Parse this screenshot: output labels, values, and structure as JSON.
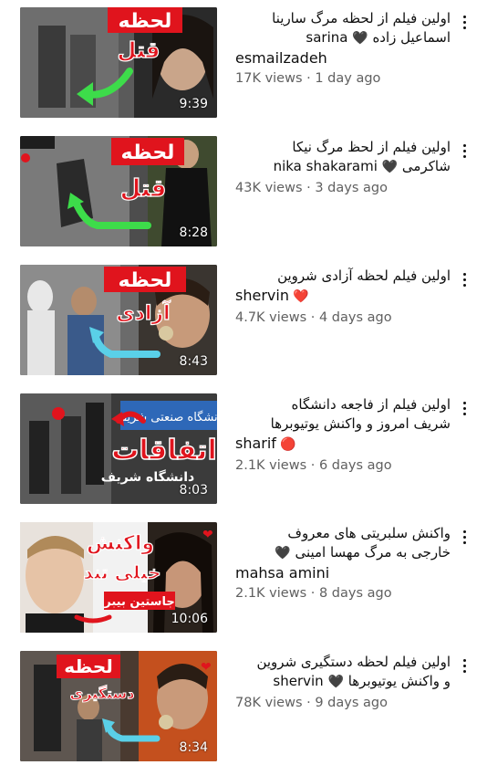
{
  "videos": [
    {
      "title_lines": [
        "اولین فیلم از لحظه مرگ سارینا",
        "اسماعیل زاده"
      ],
      "title_inline_emoji": "🖤",
      "latin_line": "esmailzadeh",
      "latin_prefix": "sarina",
      "latin_emoji": "",
      "duration": "9:39",
      "views": "17K views",
      "age": "1 day ago",
      "thumb_text_1": "لحظه",
      "thumb_text_2": "قتل",
      "thumb_icon": "green-arrow"
    },
    {
      "title_lines": [
        "اولین فیلم از لحظ مرگ نیکا",
        "شاکرمی"
      ],
      "title_inline_emoji": "🖤",
      "latin_line": "nika shakarami",
      "duration": "8:28",
      "views": "43K views",
      "age": "3 days ago",
      "thumb_text_1": "لحظه",
      "thumb_text_2": "قتل",
      "thumb_icon": "green-arrow"
    },
    {
      "title_lines": [
        "اولین فیلم لحظه آزادی شروین"
      ],
      "latin_line": "shervin",
      "latin_emoji": "❤️",
      "duration": "8:43",
      "views": "4.7K views",
      "age": "4 days ago",
      "thumb_text_1": "لحظه",
      "thumb_text_2": "آزادی",
      "thumb_icon": "cyan-arrow"
    },
    {
      "title_lines": [
        "اولین فیلم از فاجعه دانشگاه",
        "شریف امروز و واکنش یوتیوبرها"
      ],
      "latin_line": "sharif",
      "latin_emoji": "🔴",
      "duration": "8:03",
      "views": "2.1K views",
      "age": "6 days ago",
      "thumb_text_1": "اتفاقات",
      "thumb_text_2": "دانشگاه شریف",
      "thumb_sign": "دانشگاه صنعتی شریف",
      "thumb_icon": "red-arrow"
    },
    {
      "title_lines": [
        "واکنش سلبریتی های معروف",
        "خارجی به مرگ مهسا امینی"
      ],
      "title_inline_emoji": "🖤",
      "latin_line": "mahsa amini",
      "duration": "10:06",
      "views": "2.1K views",
      "age": "8 days ago",
      "thumb_text_1": "واکنش",
      "thumb_text_2": "خیلی تند",
      "thumb_text_3": "جاستین بیبر",
      "thumb_icon": "red-arrow"
    },
    {
      "title_lines": [
        "اولین فیلم لحظه دستگیری شروین",
        "و واکنش یوتیوبرها"
      ],
      "title_inline_emoji": "🖤",
      "latin_line": "shervin",
      "duration": "8:34",
      "views": "78K views",
      "age": "9 days ago",
      "thumb_text_1": "لحظه",
      "thumb_text_2": "دستگیری",
      "thumb_icon": "cyan-arrow"
    }
  ],
  "menu_icon": "more-vert-icon",
  "separator": "·",
  "colors": {
    "text_primary": "#0f0f0f",
    "text_secondary": "#606060",
    "thumb_red": "#e0141d",
    "arrow_green": "#3ddc4a",
    "arrow_cyan": "#5ad0e8"
  }
}
